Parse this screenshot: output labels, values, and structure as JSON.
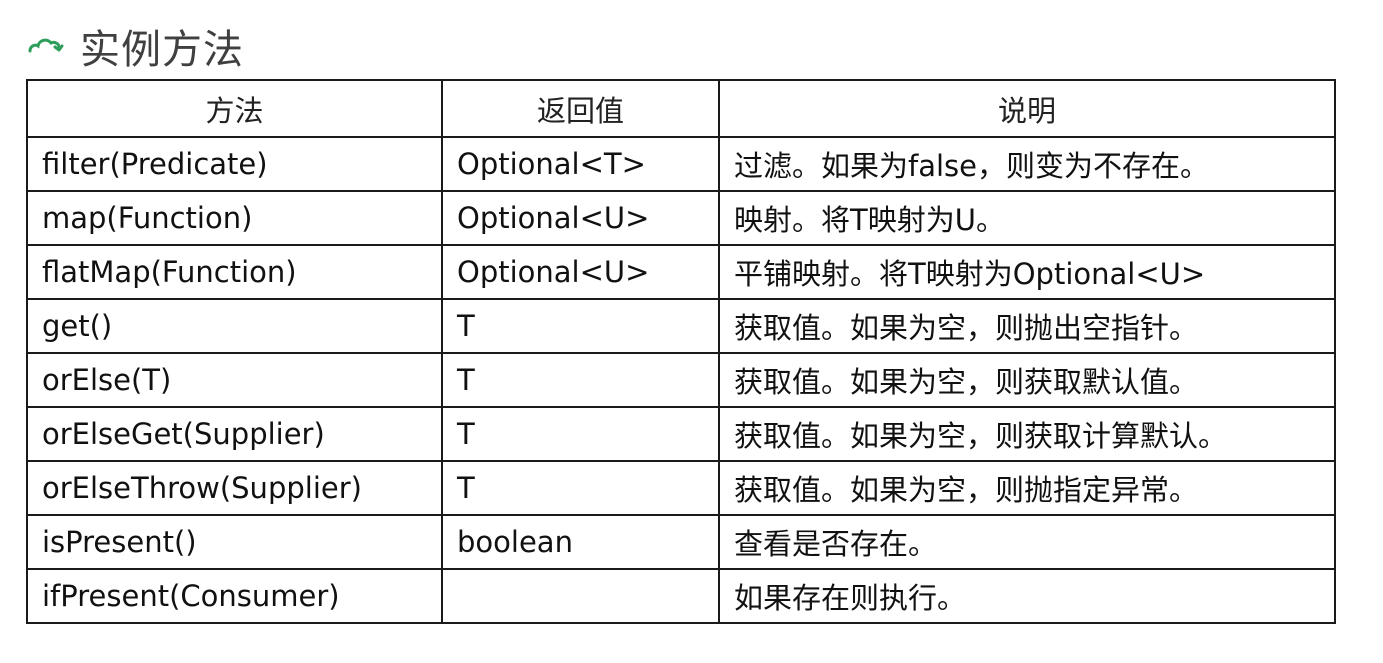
{
  "heading": {
    "title": "实例方法",
    "icon": "cloud-outline-icon",
    "icon_color": "#2e9e5b"
  },
  "table": {
    "columns": [
      "方法",
      "返回值",
      "说明"
    ],
    "rows": [
      {
        "method": "filter(Predicate)",
        "returns": "Optional<T>",
        "description": "过滤。如果为false，则变为不存在。"
      },
      {
        "method": "map(Function)",
        "returns": "Optional<U>",
        "description": "映射。将T映射为U。"
      },
      {
        "method": "flatMap(Function)",
        "returns": "Optional<U>",
        "description": "平铺映射。将T映射为Optional<U>"
      },
      {
        "method": "get()",
        "returns": "T",
        "description": "获取值。如果为空，则抛出空指针。"
      },
      {
        "method": "orElse(T)",
        "returns": "T",
        "description": "获取值。如果为空，则获取默认值。"
      },
      {
        "method": "orElseGet(Supplier)",
        "returns": "T",
        "description": "获取值。如果为空，则获取计算默认。"
      },
      {
        "method": "orElseThrow(Supplier)",
        "returns": "T",
        "description": "获取值。如果为空，则抛指定异常。"
      },
      {
        "method": "isPresent()",
        "returns": "boolean",
        "description": "查看是否存在。"
      },
      {
        "method": "ifPresent(Consumer)",
        "returns": "",
        "description": "如果存在则执行。"
      }
    ]
  }
}
